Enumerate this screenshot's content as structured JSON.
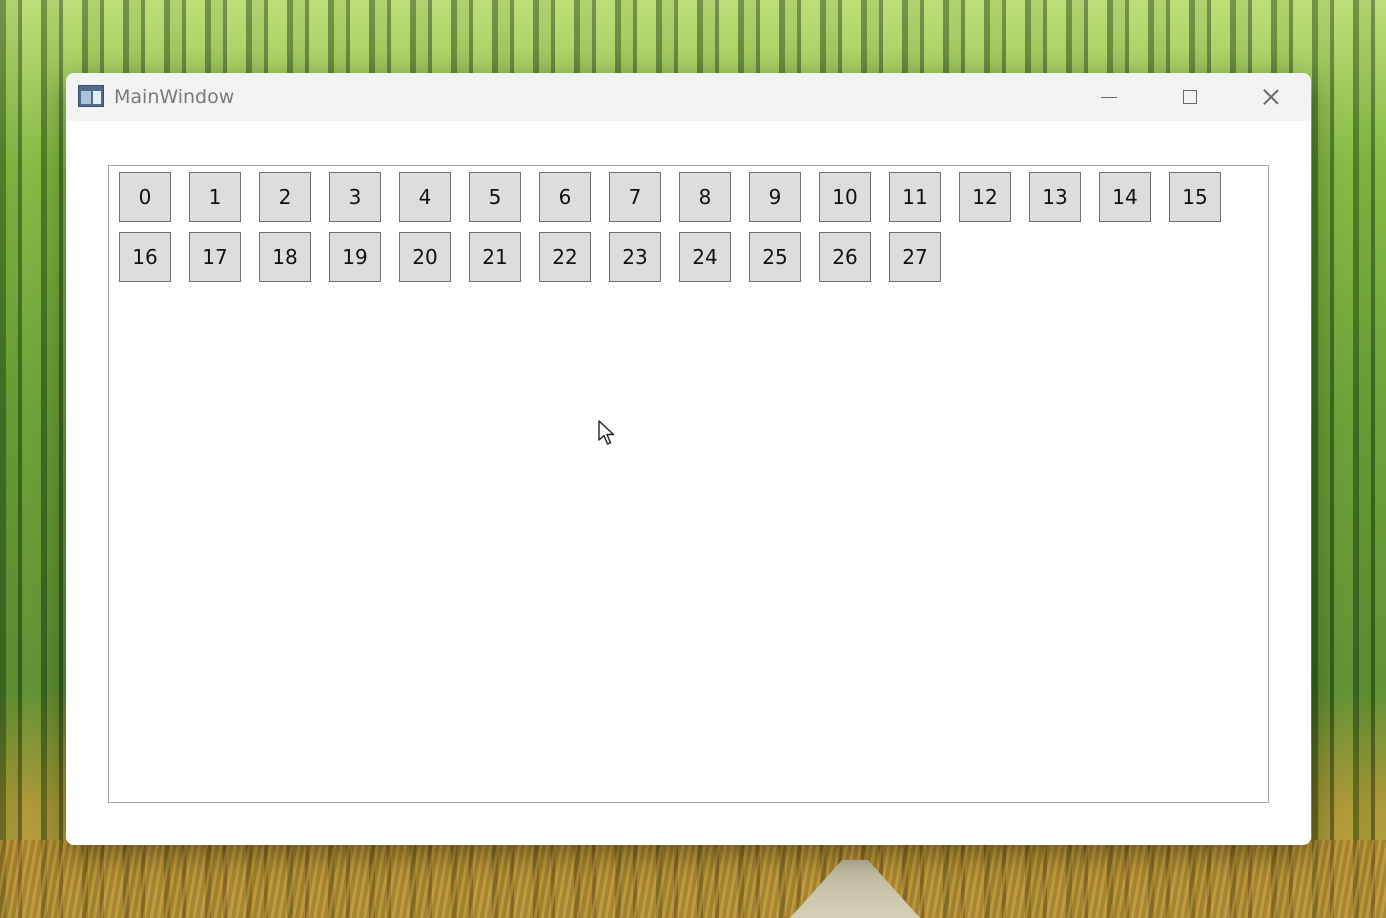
{
  "window": {
    "title": "MainWindow",
    "icon": "app-window-icon",
    "caption_buttons": {
      "minimize": "minimize-icon",
      "maximize": "maximize-icon",
      "close": "close-icon"
    }
  },
  "buttons": [
    "0",
    "1",
    "2",
    "3",
    "4",
    "5",
    "6",
    "7",
    "8",
    "9",
    "10",
    "11",
    "12",
    "13",
    "14",
    "15",
    "16",
    "17",
    "18",
    "19",
    "20",
    "21",
    "22",
    "23",
    "24",
    "25",
    "26",
    "27"
  ],
  "colors": {
    "titlebar": "#f3f3f3",
    "button_face": "#dddddd",
    "button_border": "#707070",
    "panel_border": "#a8a8a8"
  }
}
